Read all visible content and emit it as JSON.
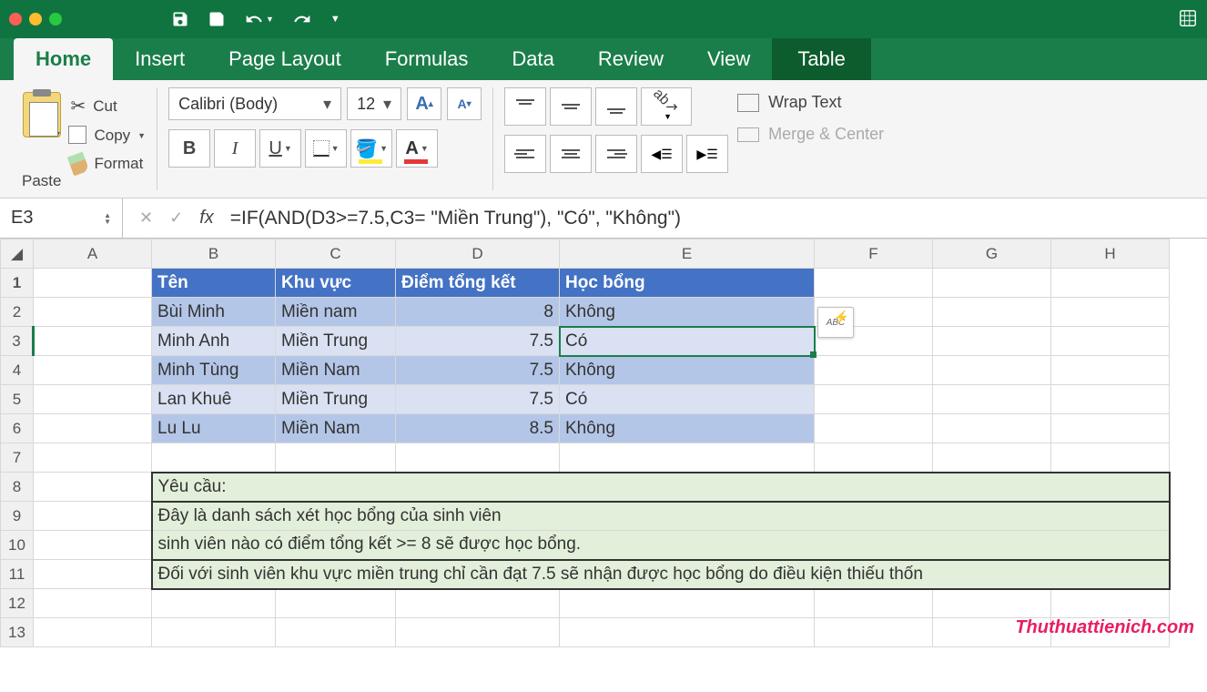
{
  "qat": {
    "save": "Save",
    "undo": "Undo",
    "redo": "Redo"
  },
  "tabs": [
    "Home",
    "Insert",
    "Page Layout",
    "Formulas",
    "Data",
    "Review",
    "View",
    "Table"
  ],
  "active_tab": "Home",
  "clipboard": {
    "paste": "Paste",
    "cut": "Cut",
    "copy": "Copy",
    "format": "Format"
  },
  "font": {
    "name": "Calibri (Body)",
    "size": "12",
    "bold": "B",
    "italic": "I",
    "underline": "U",
    "grow": "A",
    "shrink": "A"
  },
  "align": {
    "wrap": "Wrap Text",
    "merge": "Merge & Center"
  },
  "namebox": "E3",
  "formula": "=IF(AND(D3>=7.5,C3= \"Miền Trung\"), \"Có\", \"Không\")",
  "columns": [
    "A",
    "B",
    "C",
    "D",
    "E",
    "F",
    "G",
    "H"
  ],
  "rows": [
    "1",
    "2",
    "3",
    "4",
    "5",
    "6",
    "7",
    "8",
    "9",
    "10",
    "11",
    "12",
    "13"
  ],
  "table": {
    "headers": [
      "Tên",
      "Khu vực",
      "Điểm tổng kết",
      "Học bổng"
    ],
    "data": [
      [
        "Bùi Minh",
        "Miền nam",
        "8",
        "Không"
      ],
      [
        "Minh Anh",
        "Miền Trung",
        "7.5",
        "Có"
      ],
      [
        "Minh Tùng",
        "Miền Nam",
        "7.5",
        "Không"
      ],
      [
        "Lan Khuê",
        "Miền Trung",
        "7.5",
        "Có"
      ],
      [
        "Lu Lu",
        "Miền Nam",
        "8.5",
        "Không"
      ]
    ]
  },
  "note": {
    "l1": "Yêu cầu:",
    "l2": "Đây là danh sách xét học bổng của sinh viên",
    "l3": "sinh viên nào có điểm tổng kết >= 8 sẽ được học bổng.",
    "l4": "Đối với sinh viên khu vực miền trung chỉ cần đạt 7.5 sẽ nhận được học bổng do điều kiện thiếu thốn"
  },
  "autofill_badge": "ABC",
  "watermark": "Thuthuattienich.com"
}
